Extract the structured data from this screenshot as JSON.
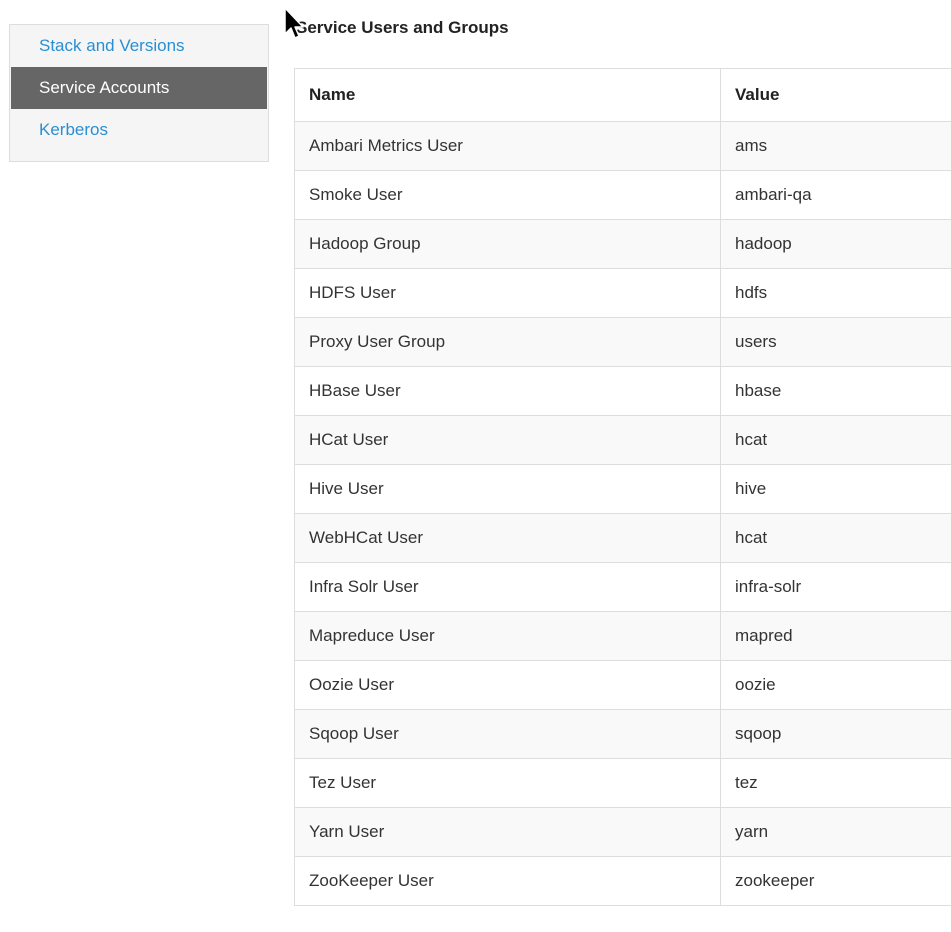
{
  "sidebar": {
    "items": [
      {
        "label": "Stack and Versions",
        "active": false
      },
      {
        "label": "Service Accounts",
        "active": true
      },
      {
        "label": "Kerberos",
        "active": false
      }
    ]
  },
  "main": {
    "title": "Service Users and Groups",
    "table": {
      "headers": [
        "Name",
        "Value"
      ],
      "rows": [
        {
          "name": "Ambari Metrics User",
          "value": "ams"
        },
        {
          "name": "Smoke User",
          "value": "ambari-qa"
        },
        {
          "name": "Hadoop Group",
          "value": "hadoop"
        },
        {
          "name": "HDFS User",
          "value": "hdfs"
        },
        {
          "name": "Proxy User Group",
          "value": "users"
        },
        {
          "name": "HBase User",
          "value": "hbase"
        },
        {
          "name": "HCat User",
          "value": "hcat"
        },
        {
          "name": "Hive User",
          "value": "hive"
        },
        {
          "name": "WebHCat User",
          "value": "hcat"
        },
        {
          "name": "Infra Solr User",
          "value": "infra-solr"
        },
        {
          "name": "Mapreduce User",
          "value": "mapred"
        },
        {
          "name": "Oozie User",
          "value": "oozie"
        },
        {
          "name": "Sqoop User",
          "value": "sqoop"
        },
        {
          "name": "Tez User",
          "value": "tez"
        },
        {
          "name": "Yarn User",
          "value": "yarn"
        },
        {
          "name": "ZooKeeper User",
          "value": "zookeeper"
        }
      ]
    }
  },
  "colors": {
    "link": "#2a8fd1",
    "active_bg": "#666666",
    "sidebar_bg": "#f5f5f5",
    "border": "#dddddd",
    "stripe": "#f9f9f9"
  },
  "icons": {
    "cursor": "mouse-pointer-icon"
  }
}
